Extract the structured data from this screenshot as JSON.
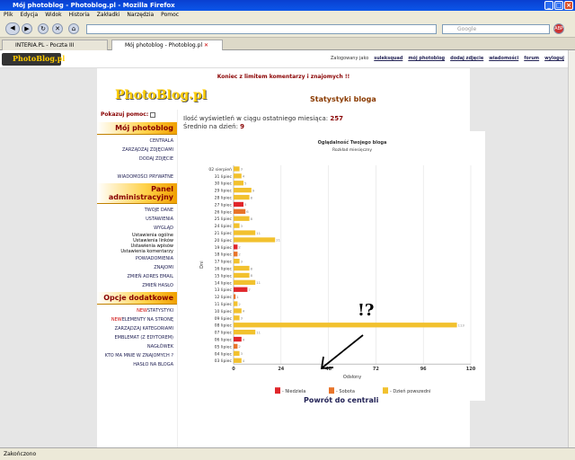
{
  "window": {
    "title": "Mój photoblog - Photoblog.pl - Mozilla Firefox"
  },
  "menu": [
    "Plik",
    "Edycja",
    "Widok",
    "Historia",
    "Zakładki",
    "Narzędzia",
    "Pomoc"
  ],
  "search": {
    "placeholder": "Google"
  },
  "tabs": [
    {
      "label": "INTERIA.PL - Poczta III"
    },
    {
      "label": "Mój photoblog - Photoblog.pl"
    }
  ],
  "status": "Zakończono",
  "header": {
    "logo": "PhotoBlog.pl",
    "logged_label": "Zalogowany jako",
    "username": "suleksquad",
    "links": [
      "mój photoblog",
      "dodaj zdjęcie",
      "wiadomości",
      "forum",
      "wyloguj"
    ]
  },
  "notice": "Koniec z limitem komentarzy i znajomych !!",
  "blog_logo": "PhotoBlog.pl",
  "page_title": "Statystyki bloga",
  "sidebar": {
    "help_label": "Pokazuj pomoc:",
    "sections": [
      {
        "title": "Mój photoblog",
        "items": [
          "CENTRALA",
          "ZARZĄDZAJ ZDJĘCIAMI",
          "DODAJ ZDJĘCIE",
          "",
          "WIADOMOŚCI PRYWATNE"
        ]
      },
      {
        "title": "Panel administracyjny",
        "items": [
          "TWOJE DANE",
          "USTAWIENIA",
          "WYGLĄD",
          "Ustawienia ogólne",
          "Ustawienia linków",
          "Ustawienia wpisów",
          "Ustawienia komentarzy",
          "POWIADOMIENIA",
          "ZNAJOMI",
          "ZMIEŃ ADRES EMAIL",
          "ZMIEŃ HASŁO"
        ]
      },
      {
        "title": "Opcje dodatkowe",
        "items": [
          "STATYSTYKI",
          "ELEMENTY NA STRONĘ",
          "ZARZĄDZAJ KATEGORIAMI",
          "EMBLEMAT (Z EDYTOREM)",
          "NAGŁÓWEK",
          "KTO MA MNIE W ZNAJOMYCH ?",
          "HASŁO NA BLOGA"
        ]
      }
    ],
    "new_badge": "NEW"
  },
  "stats": {
    "views_label": "Ilość wyświetleń w ciągu ostatniego miesiąca:",
    "views_value": "257",
    "avg_label": "Średnio na dzień:",
    "avg_value": "9"
  },
  "annotation": "!?",
  "back_link": "Powrót do centrali",
  "chart_data": {
    "type": "bar",
    "title": "Oglądalność Twojego bloga",
    "subtitle": "Rozkład miesięczny",
    "xlabel": "Odsłony",
    "ylabel": "Dni",
    "xlim": [
      0,
      120
    ],
    "xticks": [
      0,
      24,
      48,
      72,
      96,
      120
    ],
    "categories": [
      "02 sierpień",
      "31 lipiec",
      "30 lipiec",
      "29 lipiec",
      "28 lipiec",
      "27 lipiec",
      "26 lipiec",
      "25 lipiec",
      "24 lipiec",
      "21 lipiec",
      "20 lipiec",
      "19 lipiec",
      "18 lipiec",
      "17 lipiec",
      "16 lipiec",
      "15 lipiec",
      "14 lipiec",
      "13 lipiec",
      "12 lipiec",
      "11 lipiec",
      "10 lipiec",
      "09 lipiec",
      "08 lipiec",
      "07 lipiec",
      "06 lipiec",
      "05 lipiec",
      "04 lipiec",
      "03 lipiec"
    ],
    "values": [
      3,
      4,
      5,
      9,
      8,
      5,
      6,
      8,
      3,
      11,
      21,
      2,
      2,
      3,
      8,
      8,
      11,
      7,
      1,
      2,
      4,
      3,
      113,
      11,
      4,
      2,
      3,
      4
    ],
    "day_type": [
      "workday",
      "workday",
      "workday",
      "workday",
      "workday",
      "sunday",
      "saturday",
      "workday",
      "workday",
      "workday",
      "workday",
      "sunday",
      "saturday",
      "workday",
      "workday",
      "workday",
      "workday",
      "sunday",
      "saturday",
      "workday",
      "workday",
      "workday",
      "workday",
      "workday",
      "sunday",
      "saturday",
      "workday",
      "workday"
    ],
    "legend": [
      {
        "name": "Niedziela",
        "color": "#e0262b"
      },
      {
        "name": "Sobota",
        "color": "#e8742a"
      },
      {
        "name": "Dzień powszedni",
        "color": "#f2c12e"
      }
    ]
  }
}
